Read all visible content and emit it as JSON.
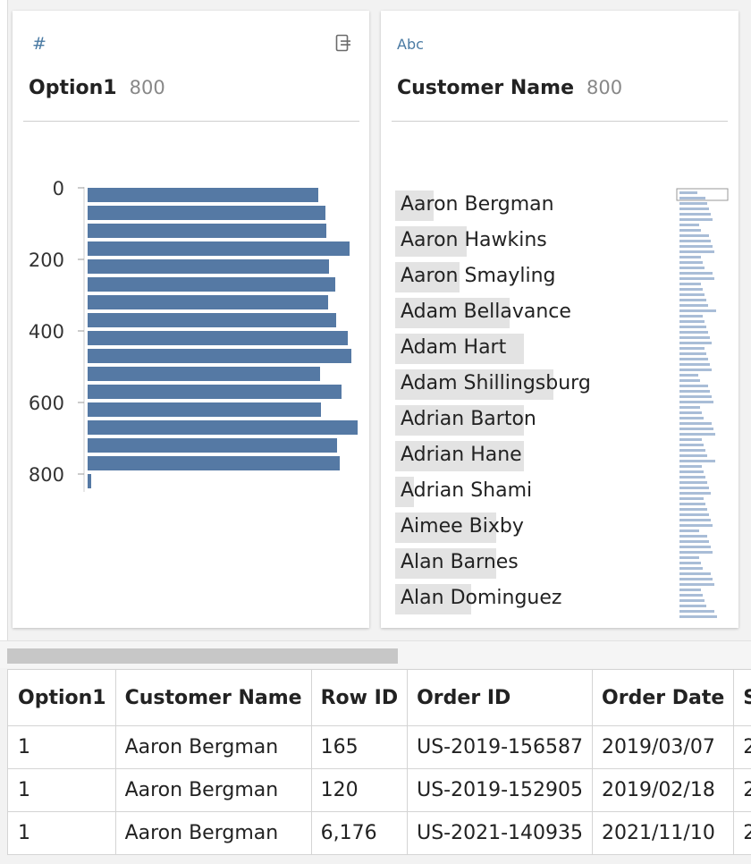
{
  "cards": [
    {
      "type_icon": "number-icon",
      "type_glyph": "#",
      "title": "Option1",
      "count": "800",
      "histogram": {
        "axis_ticks": [
          "0",
          "200",
          "400",
          "600",
          "800"
        ],
        "bin_values": [
          258,
          266,
          267,
          293,
          270,
          277,
          269,
          278,
          291,
          295,
          260,
          284,
          261,
          302,
          279,
          282,
          4
        ]
      }
    },
    {
      "type_icon": "text-abc-icon",
      "type_glyph": "Abc",
      "title": "Customer Name",
      "count": "800",
      "values": [
        {
          "name": "Aaron Bergman",
          "freq": 0.22
        },
        {
          "name": "Aaron Hawkins",
          "freq": 0.41
        },
        {
          "name": "Aaron Smayling",
          "freq": 0.37
        },
        {
          "name": "Adam Bellavance",
          "freq": 0.66
        },
        {
          "name": "Adam Hart",
          "freq": 0.74
        },
        {
          "name": "Adam Shillingsburg",
          "freq": 0.91
        },
        {
          "name": "Adrian Barton",
          "freq": 0.74
        },
        {
          "name": "Adrian Hane",
          "freq": 0.74
        },
        {
          "name": "Adrian Shami",
          "freq": 0.11
        },
        {
          "name": "Aimee Bixby",
          "freq": 0.58
        },
        {
          "name": "Alan Barnes",
          "freq": 0.58
        },
        {
          "name": "Alan Dominguez",
          "freq": 0.44
        }
      ]
    }
  ],
  "table": {
    "columns": [
      "Option1",
      "Customer Name",
      "Row ID",
      "Order ID",
      "Order Date",
      "S"
    ],
    "rows": [
      [
        "1",
        "Aaron Bergman",
        "165",
        "US-2019-156587",
        "2019/03/07",
        "2"
      ],
      [
        "1",
        "Aaron Bergman",
        "120",
        "US-2019-152905",
        "2019/02/18",
        "2"
      ],
      [
        "1",
        "Aaron Bergman",
        "6,176",
        "US-2021-140935",
        "2021/11/10",
        "2"
      ]
    ]
  },
  "colors": {
    "bar": "#5579a4",
    "name_bar": "#e3e3e3",
    "mini_bar": "#a9bdd7",
    "icon": "#4a7aa3"
  }
}
